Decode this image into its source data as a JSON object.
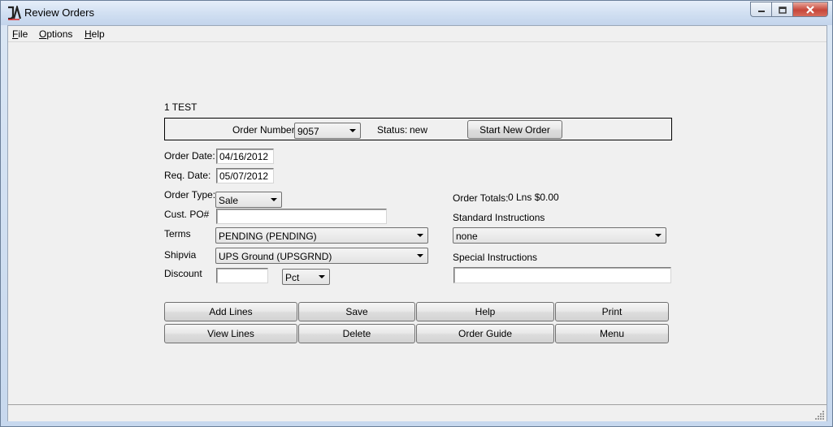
{
  "window": {
    "title": "Review Orders",
    "icon": "ja-logo-icon"
  },
  "menubar": {
    "items": [
      {
        "label": "File",
        "accel": "F",
        "rest": "ile"
      },
      {
        "label": "Options",
        "accel": "O",
        "rest": "ptions"
      },
      {
        "label": "Help",
        "accel": "H",
        "rest": "elp"
      }
    ]
  },
  "customer": {
    "name": "1 TEST"
  },
  "order": {
    "number_label": "Order Number:",
    "number": "9057",
    "status_label": "Status:",
    "status": "new",
    "start_new_label": "Start New Order"
  },
  "fields": {
    "order_date": {
      "label": "Order Date:",
      "value": "04/16/2012"
    },
    "req_date": {
      "label": "Req. Date:",
      "value": "05/07/2012"
    },
    "order_type": {
      "label": "Order Type:",
      "value": "Sale"
    },
    "cust_po": {
      "label": "Cust. PO#",
      "value": ""
    },
    "terms": {
      "label": "Terms",
      "value": "PENDING (PENDING)"
    },
    "shipvia": {
      "label": "Shipvia",
      "value": "UPS Ground (UPSGRND)"
    },
    "discount": {
      "label": "Discount",
      "value": "",
      "unit": "Pct"
    }
  },
  "totals": {
    "label": "Order Totals:",
    "value": "0 Lns $0.00"
  },
  "instructions": {
    "standard_label": "Standard Instructions",
    "standard_value": "none",
    "special_label": "Special Instructions",
    "special_value": ""
  },
  "buttons": {
    "add_lines": "Add Lines",
    "save": "Save",
    "help": "Help",
    "print": "Print",
    "view_lines": "View Lines",
    "delete": "Delete",
    "order_guide": "Order Guide",
    "menu": "Menu"
  },
  "colors": {
    "title_gradient_top": "#e6eef9",
    "close_button": "#c7473a",
    "client_bg": "#f0f0f0"
  }
}
